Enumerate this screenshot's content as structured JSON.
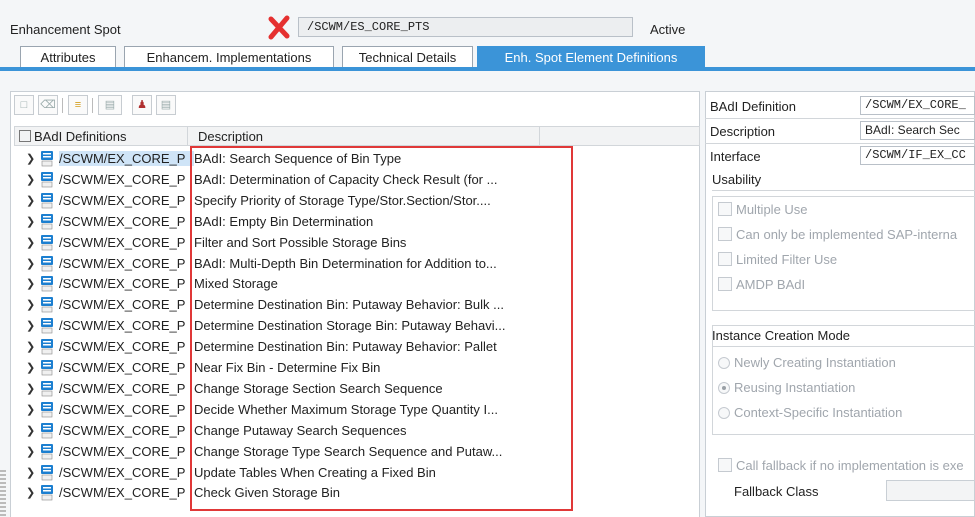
{
  "header": {
    "label": "Enhancement Spot",
    "spot_name": "/SCWM/ES_CORE_PTS",
    "status": "Active"
  },
  "tabs": [
    {
      "label": "Attributes",
      "active": false
    },
    {
      "label": "Enhancem. Implementations",
      "active": false
    },
    {
      "label": "Technical Details",
      "active": false
    },
    {
      "label": "Enh. Spot Element Definitions",
      "active": true
    }
  ],
  "toolbar": {
    "icons": [
      "new-icon",
      "delete-icon",
      "hierarchy-icon",
      "display-icon",
      "users-icon",
      "copy-icon"
    ]
  },
  "table": {
    "columns": [
      "BAdI Definitions",
      "Description"
    ],
    "rows": [
      {
        "name": "/SCWM/EX_CORE_P",
        "desc": "BAdI: Search Sequence of Bin Type"
      },
      {
        "name": "/SCWM/EX_CORE_P",
        "desc": "BAdI: Determination of Capacity Check Result (for ..."
      },
      {
        "name": "/SCWM/EX_CORE_P",
        "desc": "Specify Priority of Storage Type/Stor.Section/Stor...."
      },
      {
        "name": "/SCWM/EX_CORE_P",
        "desc": "BAdI: Empty Bin Determination"
      },
      {
        "name": "/SCWM/EX_CORE_P",
        "desc": "Filter and Sort Possible Storage Bins"
      },
      {
        "name": "/SCWM/EX_CORE_P",
        "desc": "BAdI: Multi-Depth Bin Determination for Addition to..."
      },
      {
        "name": "/SCWM/EX_CORE_P",
        "desc": "Mixed Storage"
      },
      {
        "name": "/SCWM/EX_CORE_P",
        "desc": "Determine Destination Bin: Putaway Behavior: Bulk ..."
      },
      {
        "name": "/SCWM/EX_CORE_P",
        "desc": "Determine Destination Storage Bin: Putaway Behavi..."
      },
      {
        "name": "/SCWM/EX_CORE_P",
        "desc": "Determine Destination Bin: Putaway Behavior: Pallet"
      },
      {
        "name": "/SCWM/EX_CORE_P",
        "desc": "Near Fix Bin - Determine Fix Bin"
      },
      {
        "name": "/SCWM/EX_CORE_P",
        "desc": "Change Storage Section Search Sequence"
      },
      {
        "name": "/SCWM/EX_CORE_P",
        "desc": "Decide Whether Maximum Storage Type Quantity I..."
      },
      {
        "name": "/SCWM/EX_CORE_P",
        "desc": "Change Putaway Search Sequences"
      },
      {
        "name": "/SCWM/EX_CORE_P",
        "desc": "Change Storage Type Search Sequence and Putaw..."
      },
      {
        "name": "/SCWM/EX_CORE_P",
        "desc": "Update Tables When Creating a Fixed Bin"
      },
      {
        "name": "/SCWM/EX_CORE_P",
        "desc": "Check Given Storage Bin"
      }
    ]
  },
  "details": {
    "badi_definition_label": "BAdI Definition",
    "badi_definition_value": "/SCWM/EX_CORE_",
    "description_label": "Description",
    "description_value": "BAdI: Search Sec",
    "interface_label": "Interface",
    "interface_value": "/SCWM/IF_EX_CC",
    "usability_title": "Usability",
    "usability_options": [
      "Multiple Use",
      "Can only be implemented SAP-interna",
      "Limited Filter Use",
      "AMDP BAdI"
    ],
    "instance_title": "Instance Creation Mode",
    "instance_options": [
      {
        "label": "Newly Creating Instantiation",
        "selected": false
      },
      {
        "label": "Reusing Instantiation",
        "selected": true
      },
      {
        "label": "Context-Specific Instantiation",
        "selected": false
      }
    ],
    "fallback_checkbox": "Call fallback if no implementation is exe",
    "fallback_class_label": "Fallback Class",
    "fallback_class_value": ""
  },
  "colors": {
    "accent": "#3b94d8",
    "highlight_box": "#e03838",
    "error_icon": "#e53030"
  }
}
